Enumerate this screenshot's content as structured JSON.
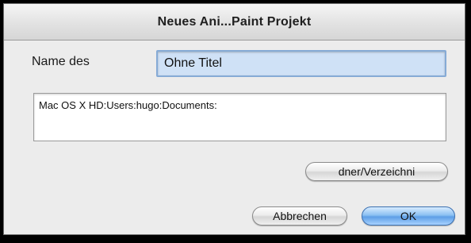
{
  "window": {
    "title": "Neues Ani...Paint Projekt"
  },
  "form": {
    "name_label": "Name des",
    "name_value": "Ohne Titel",
    "path_text": "Mac OS X HD:Users:hugo:Documents:"
  },
  "buttons": {
    "browse_label": "dner/Verzeichni",
    "cancel_label": "Abbrechen",
    "ok_label": "OK"
  },
  "colors": {
    "field_highlight": "#cfe1f6",
    "default_button": "#5e9ee6"
  }
}
